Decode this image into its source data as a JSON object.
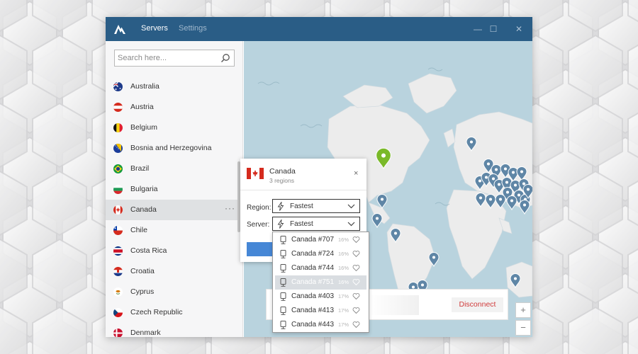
{
  "app": {
    "tabs": {
      "servers": "Servers",
      "settings": "Settings"
    },
    "window_controls": {
      "minimize": "—",
      "maximize": "☐",
      "close": "✕"
    }
  },
  "sidebar": {
    "search_placeholder": "Search here...",
    "countries": [
      {
        "label": "Australia",
        "flag": "australia-flag"
      },
      {
        "label": "Austria",
        "flag": "austria-flag"
      },
      {
        "label": "Belgium",
        "flag": "belgium-flag"
      },
      {
        "label": "Bosnia and Herzegovina",
        "flag": "bosnia-flag"
      },
      {
        "label": "Brazil",
        "flag": "brazil-flag"
      },
      {
        "label": "Bulgaria",
        "flag": "bulgaria-flag"
      },
      {
        "label": "Canada",
        "flag": "canada-flag",
        "selected": true,
        "menu": "···"
      },
      {
        "label": "Chile",
        "flag": "chile-flag"
      },
      {
        "label": "Costa Rica",
        "flag": "costa-rica-flag"
      },
      {
        "label": "Croatia",
        "flag": "croatia-flag"
      },
      {
        "label": "Cyprus",
        "flag": "cyprus-flag"
      },
      {
        "label": "Czech Republic",
        "flag": "czech-flag"
      },
      {
        "label": "Denmark",
        "flag": "denmark-flag"
      }
    ]
  },
  "popup": {
    "title": "Canada",
    "subtitle": "3 regions",
    "close": "×",
    "region_label": "Region:",
    "region_value": "Fastest",
    "server_label": "Server:",
    "server_value": "Fastest"
  },
  "dropdown": {
    "servers": [
      {
        "name": "Canada #707",
        "load": "16%"
      },
      {
        "name": "Canada #724",
        "load": "16%"
      },
      {
        "name": "Canada #744",
        "load": "16%"
      },
      {
        "name": "Canada #751",
        "load": "16%",
        "highlighted": true
      },
      {
        "name": "Canada #403",
        "load": "17%"
      },
      {
        "name": "Canada #413",
        "load": "17%"
      },
      {
        "name": "Canada #443",
        "load": "17%"
      }
    ]
  },
  "status": {
    "disconnect_label": "Disconnect"
  },
  "map": {
    "zoom_in": "+",
    "zoom_out": "−"
  },
  "colors": {
    "titlebar": "#2a5d86",
    "ocean": "#b9d3de",
    "land": "#ececec",
    "pin": "#5f86a6",
    "active_pin": "#7ab929",
    "connect": "#4687d6",
    "disconnect": "#d03a3a"
  }
}
